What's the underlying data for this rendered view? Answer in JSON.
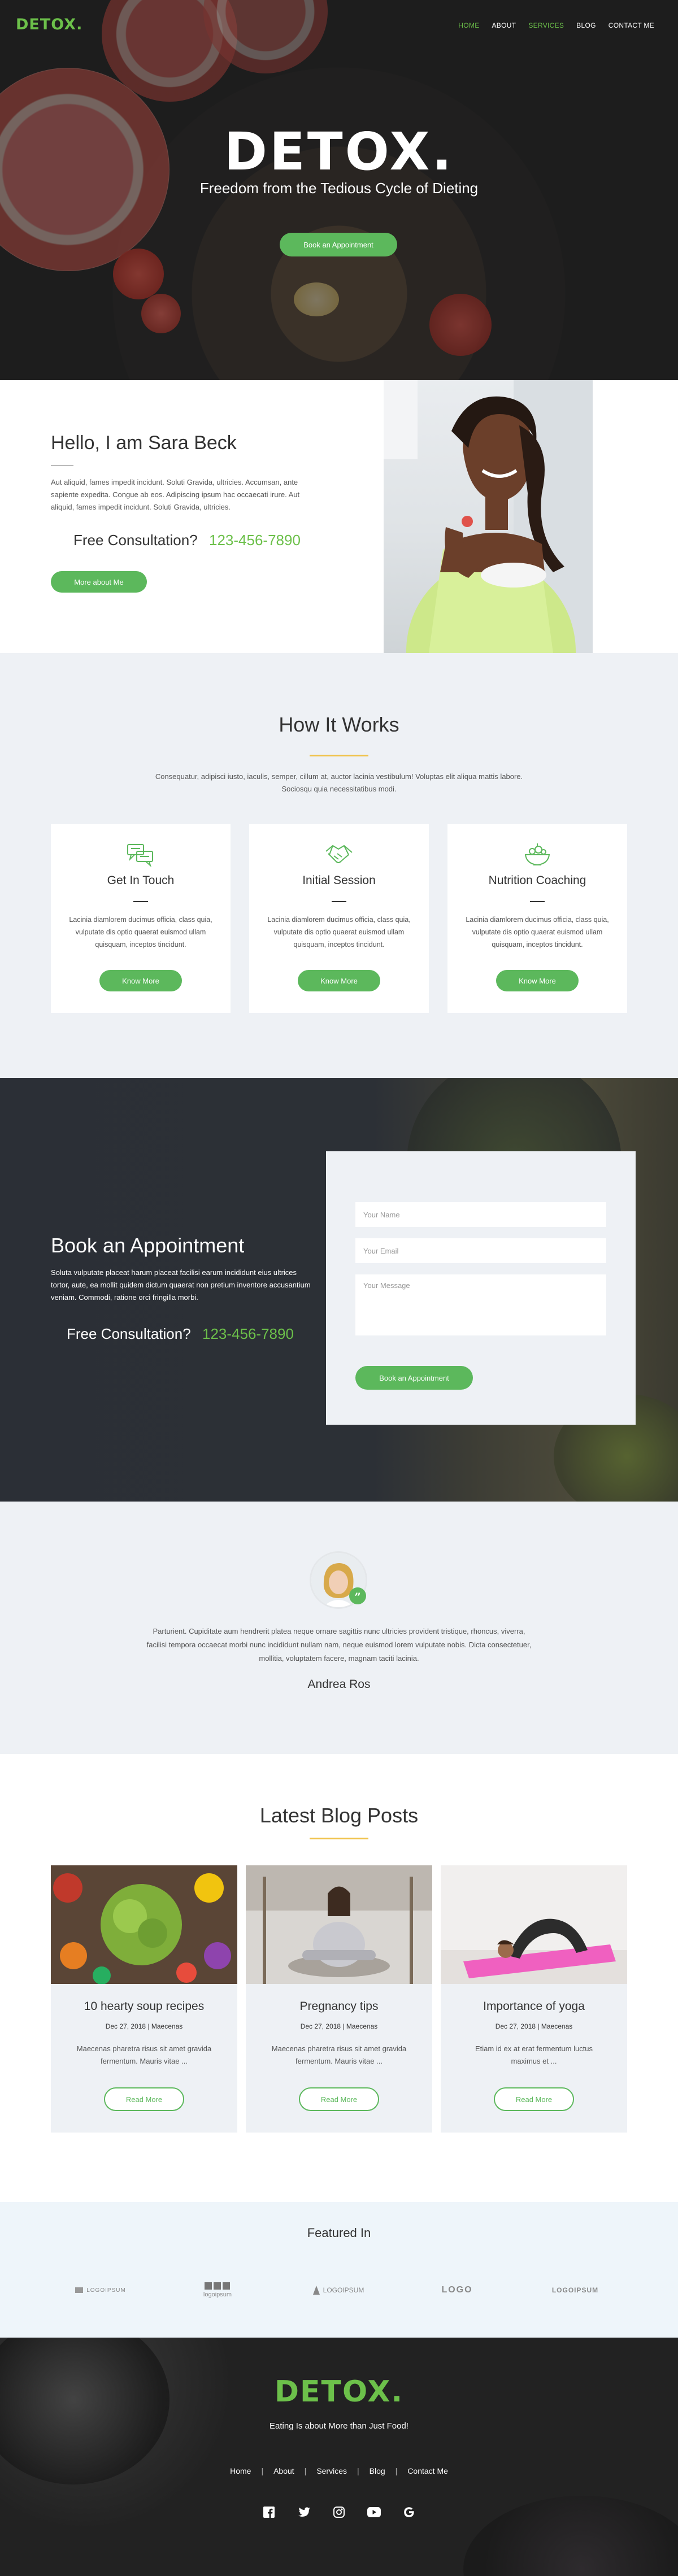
{
  "brand": {
    "logo": "DETOX.",
    "accent": "#6cc04a",
    "button_green": "#5cb85c",
    "underline_gold": "#f0c24b"
  },
  "nav": {
    "items": [
      "HOME",
      "ABOUT",
      "SERVICES",
      "BLOG",
      "CONTACT ME"
    ],
    "active": "HOME"
  },
  "hero": {
    "logo": "DETOX.",
    "tagline": "Freedom from the Tedious Cycle of Dieting",
    "button": "Book an Appointment"
  },
  "about": {
    "title": "Hello, I am Sara Beck",
    "text": "Aut aliquid, fames impedit incidunt. Soluti Gravida, ultricies. Accumsan, ante sapiente expedita. Congue ab eos. Adipiscing ipsum hac occaecati irure. Aut aliquid, fames impedit incidunt. Soluti Gravida, ultricies.",
    "consult_label": "Free Consultation?",
    "phone": "123-456-7890",
    "button": "More about Me"
  },
  "how": {
    "title": "How It Works",
    "subtitle": "Consequatur, adipisci iusto, iaculis, semper, cillum at, auctor lacinia vestibulum! Voluptas elit aliqua mattis labore. Sociosqu quia necessitatibus modi.",
    "cards": [
      {
        "icon": "chat-bubbles-icon",
        "title": "Get In Touch",
        "text": "Lacinia diamlorem ducimus officia, class quia, vulputate dis optio quaerat euismod ullam quisquam, inceptos tincidunt.",
        "button": "Know More"
      },
      {
        "icon": "handshake-icon",
        "title": "Initial Session",
        "text": "Lacinia diamlorem ducimus officia, class quia, vulputate dis optio quaerat euismod ullam quisquam, inceptos tincidunt.",
        "button": "Know More"
      },
      {
        "icon": "salad-bowl-icon",
        "title": "Nutrition Coaching",
        "text": "Lacinia diamlorem ducimus officia, class quia, vulputate dis optio quaerat euismod ullam quisquam, inceptos tincidunt.",
        "button": "Know More"
      }
    ]
  },
  "appointment": {
    "title": "Book an Appointment",
    "text": "Soluta vulputate placeat harum placeat facilisi earum incididunt eius ultrices tortor, aute, ea mollit quidem dictum quaerat non pretium inventore accusantium veniam. Commodi, ratione orci fringilla morbi.",
    "consult_label": "Free Consultation?",
    "phone": "123-456-7890",
    "form": {
      "name_placeholder": "Your Name",
      "email_placeholder": "Your Email",
      "message_placeholder": "Your Message",
      "button": "Book an Appointment"
    }
  },
  "testimonial": {
    "text": "Parturient. Cupiditate aum hendrerit platea neque ornare sagittis nunc ultricies provident tristique, rhoncus, viverra, facilisi tempora occaecat morbi nunc incididunt nullam nam, neque euismod lorem vulputate nobis. Dicta consectetuer, mollitia, voluptatem facere, magnam taciti lacinia.",
    "name": "Andrea Ros"
  },
  "blog": {
    "title": "Latest Blog Posts",
    "posts": [
      {
        "title": "10 hearty soup recipes",
        "meta": "Dec 27, 2018 | Maecenas",
        "text": "Maecenas pharetra risus sit amet gravida fermentum. Mauris vitae ...",
        "button": "Read More"
      },
      {
        "title": "Pregnancy tips",
        "meta": "Dec 27, 2018 | Maecenas",
        "text": "Maecenas pharetra risus sit amet gravida fermentum. Mauris vitae ...",
        "button": "Read More"
      },
      {
        "title": "Importance of yoga",
        "meta": "Dec 27, 2018 | Maecenas",
        "text": "Etiam id ex at erat fermentum luctus maximus et ...",
        "button": "Read More"
      }
    ]
  },
  "featured": {
    "title": "Featured In",
    "logos": [
      "LOGOIPSUM",
      "logoipsum",
      "LOGOIPSUM",
      "LOGO",
      "LOGOIPSUM"
    ]
  },
  "footer": {
    "logo": "DETOX.",
    "tagline": "Eating Is about More than Just Food!",
    "links": [
      "Home",
      "About",
      "Services",
      "Blog",
      "Contact Me"
    ],
    "social": [
      "facebook-icon",
      "twitter-icon",
      "instagram-icon",
      "youtube-icon",
      "google-icon"
    ]
  }
}
